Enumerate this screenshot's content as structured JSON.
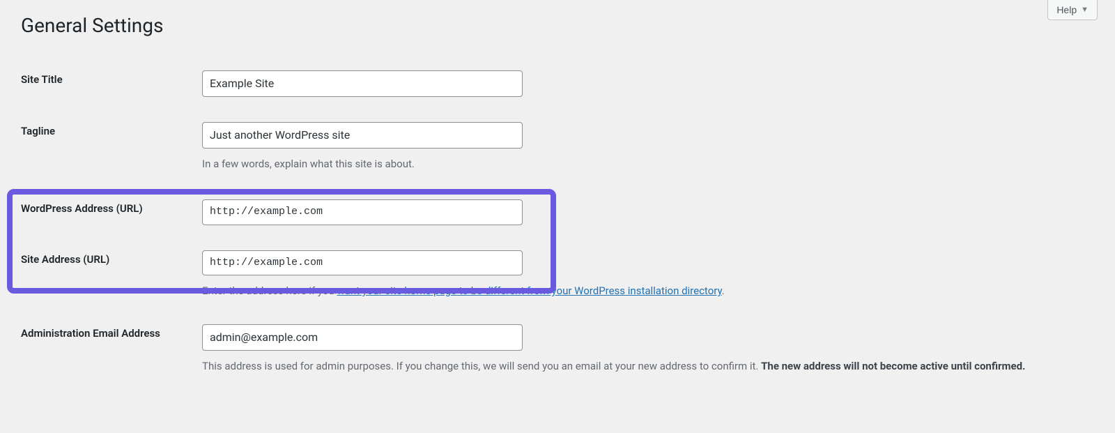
{
  "header": {
    "help_button": "Help"
  },
  "page": {
    "title": "General Settings"
  },
  "fields": {
    "site_title": {
      "label": "Site Title",
      "value": "Example Site"
    },
    "tagline": {
      "label": "Tagline",
      "value": "Just another WordPress site",
      "description": "In a few words, explain what this site is about."
    },
    "wp_address": {
      "label": "WordPress Address (URL)",
      "value": "http://example.com"
    },
    "site_address": {
      "label": "Site Address (URL)",
      "value": "http://example.com",
      "description_prefix": "Enter the address here if you ",
      "description_link": "want your site home page to be different from your WordPress installation directory",
      "description_suffix": "."
    },
    "admin_email": {
      "label": "Administration Email Address",
      "value": "admin@example.com",
      "description_prefix": "This address is used for admin purposes. If you change this, we will send you an email at your new address to confirm it. ",
      "description_strong": "The new address will not become active until confirmed."
    }
  }
}
